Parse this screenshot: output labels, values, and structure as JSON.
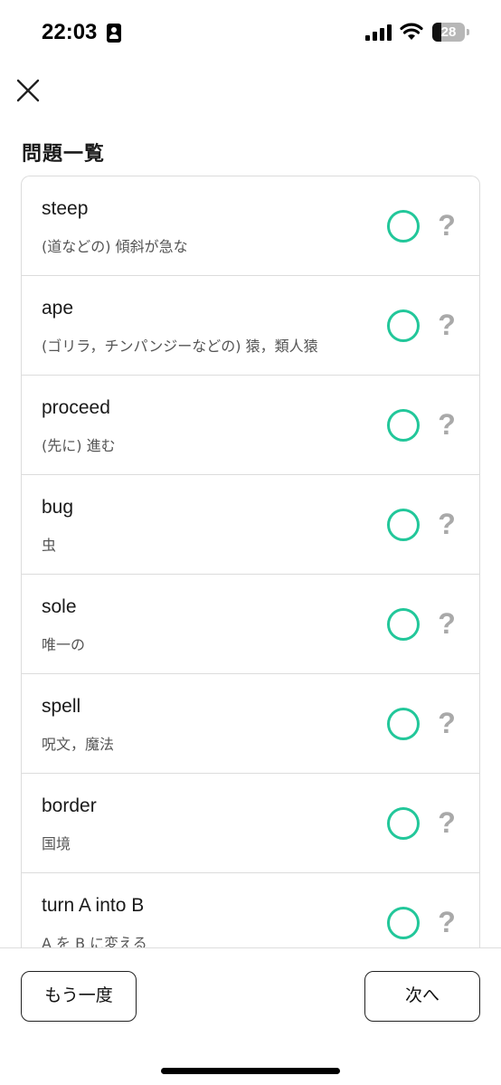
{
  "status_bar": {
    "time": "22:03",
    "battery": "28",
    "battery_level": 0.28,
    "icons": [
      "person-id-icon",
      "signal-icon",
      "wifi-icon",
      "battery-icon"
    ]
  },
  "header": {
    "close_icon": "close-icon",
    "title": "問題一覧"
  },
  "items": [
    {
      "word": "steep",
      "meaning": "(道などの) 傾斜が急な",
      "status": "correct"
    },
    {
      "word": "ape",
      "meaning": "(ゴリラ，チンパンジーなどの) 猿，類人猿",
      "status": "correct"
    },
    {
      "word": "proceed",
      "meaning": "(先に) 進む",
      "status": "correct"
    },
    {
      "word": "bug",
      "meaning": "虫",
      "status": "correct"
    },
    {
      "word": "sole",
      "meaning": "唯一の",
      "status": "correct"
    },
    {
      "word": "spell",
      "meaning": "呪文，魔法",
      "status": "correct"
    },
    {
      "word": "border",
      "meaning": "国境",
      "status": "correct"
    },
    {
      "word": "turn A into B",
      "meaning": "A を B に変える",
      "status": "correct"
    }
  ],
  "unknown_symbol": "?",
  "footer": {
    "again_label": "もう一度",
    "next_label": "次へ"
  },
  "colors": {
    "correct": "#22c79a",
    "unknown": "#a9a9a9",
    "border": "#dcdcdc"
  }
}
